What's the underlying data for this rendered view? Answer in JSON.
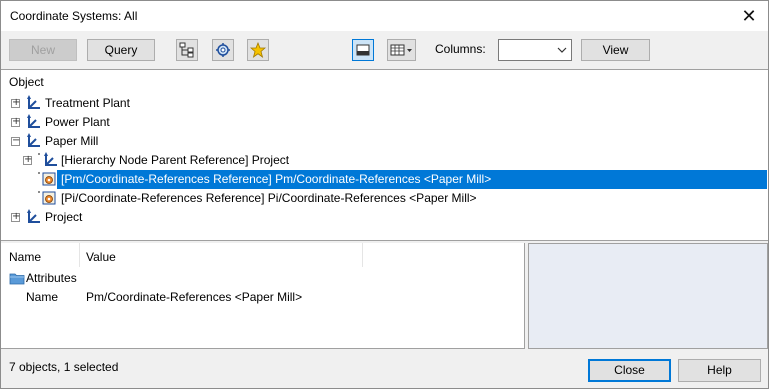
{
  "window": {
    "title": "Coordinate Systems: All",
    "close_glyph": "✕"
  },
  "toolbar": {
    "new_label": "New",
    "query_label": "Query",
    "columns_label": "Columns:",
    "columns_value": "",
    "view_label": "View"
  },
  "tree": {
    "header": "Object",
    "items": [
      {
        "label": "Treatment Plant",
        "expander": "+",
        "icon": "coordinate-system-icon"
      },
      {
        "label": "Power Plant",
        "expander": "+",
        "icon": "coordinate-system-icon"
      },
      {
        "label": "Paper Mill",
        "expander": "−",
        "icon": "coordinate-system-icon"
      },
      {
        "label": "[Hierarchy Node Parent Reference] Project",
        "expander": "+",
        "icon": "coordinate-system-icon"
      },
      {
        "label": "[Pm/Coordinate-References Reference] Pm/Coordinate-References <Paper Mill>",
        "icon": "reference-icon",
        "selected": true
      },
      {
        "label": "[Pi/Coordinate-References Reference] Pi/Coordinate-References <Paper Mill>",
        "icon": "reference-icon"
      },
      {
        "label": "Project",
        "expander": "+",
        "icon": "coordinate-system-icon"
      }
    ]
  },
  "properties": {
    "col_name": "Name",
    "col_value": "Value",
    "group_label": "Attributes",
    "row_name": "Name",
    "row_value": "Pm/Coordinate-References <Paper Mill>"
  },
  "footer": {
    "status": "7 objects, 1 selected",
    "close_label": "Close",
    "help_label": "Help"
  },
  "colors": {
    "selection": "#0078d7",
    "icon_blue": "#1f4e9c"
  }
}
